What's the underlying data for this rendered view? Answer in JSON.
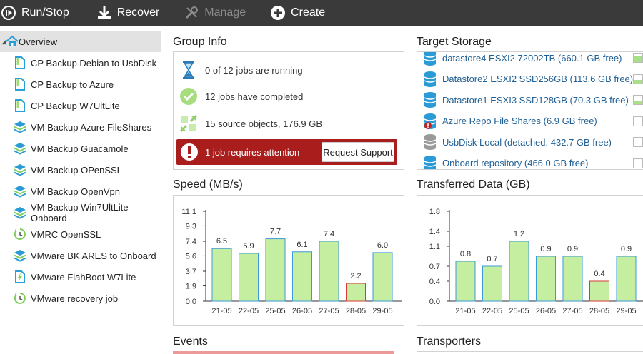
{
  "toolbar": {
    "runstop": "Run/Stop",
    "recover": "Recover",
    "manage": "Manage",
    "create": "Create"
  },
  "sidebar": {
    "items": [
      {
        "label": "Overview",
        "icon": "home-icon"
      },
      {
        "label": "CP Backup Debian to UsbDisk",
        "icon": "file-icon"
      },
      {
        "label": "CP Backup to Azure",
        "icon": "file-icon"
      },
      {
        "label": "CP Backup W7UltLite",
        "icon": "file-icon"
      },
      {
        "label": "VM Backup Azure FileShares",
        "icon": "layers-icon"
      },
      {
        "label": "VM Backup Guacamole",
        "icon": "layers-icon"
      },
      {
        "label": "VM Backup OPenSSL",
        "icon": "layers-icon"
      },
      {
        "label": "VM Backup OpenVpn",
        "icon": "layers-icon"
      },
      {
        "label": "VM Backup Win7UltLite Onboard",
        "icon": "layers-icon"
      },
      {
        "label": "VMRC OpenSSL",
        "icon": "clock-icon"
      },
      {
        "label": "VMware BK ARES to Onboard",
        "icon": "layers-icon"
      },
      {
        "label": "VMware FlahBoot W7Lite",
        "icon": "flash-icon"
      },
      {
        "label": "VMware recovery job",
        "icon": "clock-icon"
      }
    ]
  },
  "group_info": {
    "title": "Group Info",
    "running": "0 of 12 jobs are running",
    "completed": "12 jobs have completed",
    "sources": "15 source objects, 176.9 GB",
    "attention": "1 job requires attention",
    "support_button": "Request Support"
  },
  "target_storage": {
    "title": "Target Storage",
    "items": [
      {
        "label": "datastore4 ESXI2 72002TB (660.1 GB free)",
        "icon": "database-icon",
        "fill": 0.7
      },
      {
        "label": "Datastore2 ESXI2 SSD256GB (113.6 GB free)",
        "icon": "database-icon",
        "fill": 0.35
      },
      {
        "label": "Datastore1 ESXI3 SSD128GB (70.3 GB free)",
        "icon": "database-icon",
        "fill": 0.35
      },
      {
        "label": "Azure Repo File Shares (6.9 GB free)",
        "icon": "database-error-icon",
        "fill": 0
      },
      {
        "label": "UsbDisk Local (detached, 432.7 GB free)",
        "icon": "database-offline-icon",
        "fill": 0
      },
      {
        "label": "Onboard repository (466.0 GB free)",
        "icon": "database-icon",
        "fill": 0
      }
    ]
  },
  "speed": {
    "title": "Speed (MB/s)"
  },
  "transferred": {
    "title": "Transferred Data (GB)"
  },
  "events": {
    "title": "Events"
  },
  "transporters": {
    "title": "Transporters"
  },
  "colors": {
    "toolbar_bg": "#3a3a3a",
    "bar_fill": "#c5eea0",
    "bar_stroke": "#3a9ad9",
    "bar_stroke_error": "#d93a3a",
    "attention_bg": "#a91d1d",
    "link": "#1f5f95"
  },
  "chart_data": [
    {
      "type": "bar",
      "title": "Speed (MB/s)",
      "categories": [
        "21-05",
        "22-05",
        "25-05",
        "26-05",
        "27-05",
        "28-05",
        "29-05"
      ],
      "values": [
        6.5,
        5.9,
        7.7,
        6.1,
        7.4,
        2.2,
        6.0
      ],
      "yticks": [
        "0.0",
        "1.9",
        "3.7",
        "5.6",
        "7.4",
        "9.3",
        "11.1"
      ],
      "ylim": [
        0,
        11.1
      ],
      "error_index": 5,
      "grid": false
    },
    {
      "type": "bar",
      "title": "Transferred Data (GB)",
      "categories": [
        "21-05",
        "22-05",
        "25-05",
        "26-05",
        "27-05",
        "28-05",
        "29-05"
      ],
      "values": [
        0.8,
        0.7,
        1.2,
        0.9,
        0.9,
        0.4,
        0.9
      ],
      "yticks": [
        "0.0",
        "0.4",
        "0.7",
        "1.1",
        "1.4",
        "1.8"
      ],
      "ylim": [
        0,
        1.8
      ],
      "error_index": 5,
      "grid": false
    }
  ]
}
